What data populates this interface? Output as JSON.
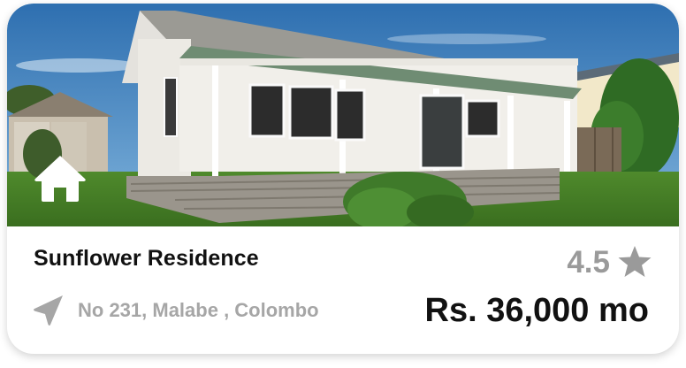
{
  "listing": {
    "title": "Sunflower Residence",
    "rating": "4.5",
    "address": "No 231, Malabe , Colombo",
    "price": "Rs. 36,000 mo"
  },
  "icons": {
    "badge": "home-icon",
    "rating": "star-icon",
    "location": "navigation-arrow-icon"
  },
  "colors": {
    "title_text": "#111111",
    "muted_text": "#a6a6a6",
    "star": "#9a9a9a",
    "card_background": "#ffffff"
  }
}
